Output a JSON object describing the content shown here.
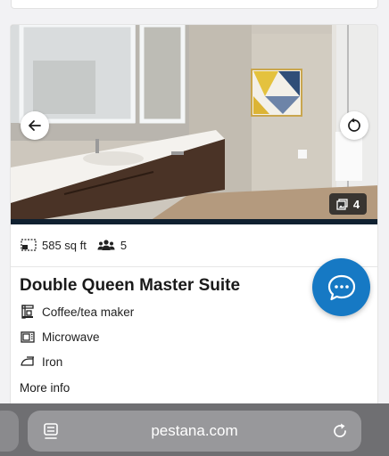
{
  "room": {
    "photo_count": "4",
    "area": "585 sq ft",
    "guests": "5",
    "title": "Double Queen Master Suite",
    "amenities": [
      {
        "label": "Coffee/tea maker",
        "icon": "coffee-maker-icon"
      },
      {
        "label": "Microwave",
        "icon": "microwave-icon"
      },
      {
        "label": "Iron",
        "icon": "iron-icon"
      }
    ],
    "more_info_label": "More info"
  },
  "browser": {
    "url": "pestana.com"
  },
  "colors": {
    "accent": "#1679c4",
    "photo_bar": "#0f2030",
    "browser_bar": "#6f6f72"
  }
}
